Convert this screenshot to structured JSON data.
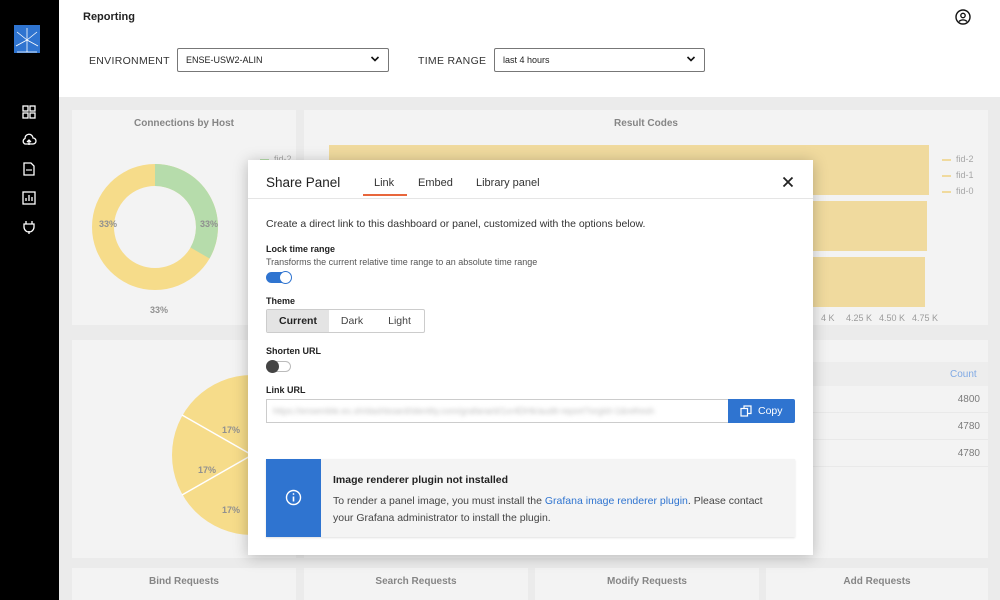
{
  "header": {
    "title": "Reporting"
  },
  "filters": {
    "environment_label": "ENVIRONMENT",
    "environment_value": "ENSE-USW2-ALIN",
    "time_range_label": "TIME RANGE",
    "time_range_value": "last 4 hours"
  },
  "panels": {
    "connections_by_host": {
      "title": "Connections by Host",
      "legend": [
        "fid-2"
      ],
      "slice_labels": [
        "33%",
        "33%",
        "33%"
      ]
    },
    "result_codes": {
      "title": "Result Codes",
      "legend": [
        "fid-2",
        "fid-1",
        "fid-0"
      ],
      "x_ticks": [
        "4 K",
        "4.25 K",
        "4.50 K",
        "4.75 K"
      ]
    },
    "pie_panel": {
      "slice_labels": [
        "17%",
        "17%",
        "17%"
      ]
    },
    "table_panel": {
      "header": "Count",
      "rows": [
        "4800",
        "4780",
        "4780"
      ]
    },
    "bottom": [
      "Bind Requests",
      "Search Requests",
      "Modify Requests",
      "Add Requests"
    ]
  },
  "colors": {
    "accent": "#2f74d0",
    "tab_underline": "#e8663c",
    "chart_yellow": "#f2c94c",
    "chart_green": "#8fc97e",
    "bar_gold": "#e8c76a"
  },
  "modal": {
    "title": "Share Panel",
    "tabs": [
      "Link",
      "Embed",
      "Library panel"
    ],
    "active_tab": "Link",
    "description": "Create a direct link to this dashboard or panel, customized with the options below.",
    "lock_time_range": {
      "label": "Lock time range",
      "description": "Transforms the current relative time range to an absolute time range",
      "enabled": true
    },
    "theme": {
      "label": "Theme",
      "options": [
        "Current",
        "Dark",
        "Light"
      ],
      "selected": "Current"
    },
    "shorten_url": {
      "label": "Shorten URL",
      "enabled": false
    },
    "link_url": {
      "label": "Link URL",
      "value": "https://ensemble.ex.sh/dashboard/identity.com/grafana/d/1xr4DHk/audit-report?orgId=1&refresh",
      "copy_label": "Copy"
    },
    "alert": {
      "title": "Image renderer plugin not installed",
      "body_before": "To render a panel image, you must install the ",
      "link_text": "Grafana image renderer plugin",
      "body_after": ". Please contact your Grafana administrator to install the plugin."
    }
  }
}
